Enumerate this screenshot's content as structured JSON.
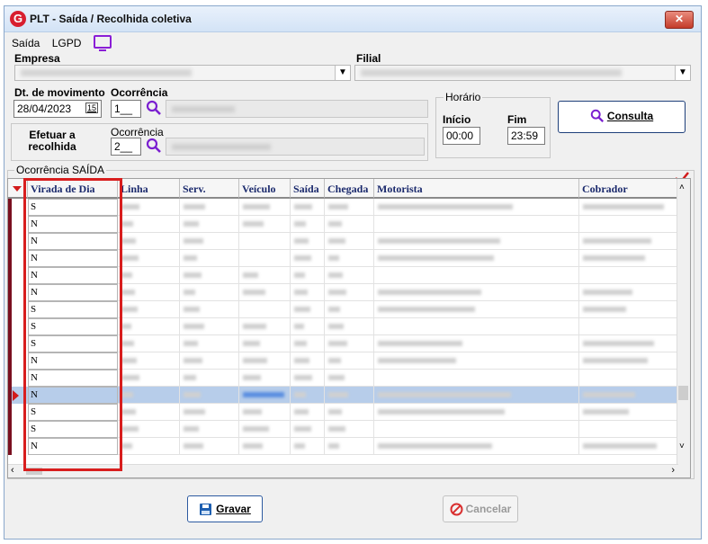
{
  "window": {
    "title": "PLT - Saída / Recolhida coletiva",
    "app_icon": "G",
    "close": "✕"
  },
  "menu": {
    "items": [
      "Saída",
      "LGPD"
    ],
    "icon": "monitor-icon"
  },
  "form": {
    "empresa_label": "Empresa",
    "filial_label": "Filial",
    "dt_label": "Dt. de movimento",
    "dt_value": "28/04/2023",
    "calendar_glyph": "15",
    "ocorrencia_label": "Ocorrência",
    "ocorrencia_value": "1__",
    "horario_label": "Horário",
    "inicio_label": "Início",
    "inicio_value": "00:00",
    "fim_label": "Fim",
    "fim_value": "23:59",
    "efetuar_label": "Efetuar a recolhida",
    "ocorrencia2_label": "Ocorrência",
    "ocorrencia2_value": "2__",
    "consulta_label": "Consulta"
  },
  "grid": {
    "group_title": "Ocorrência SAÍDA",
    "columns": [
      "Virada de Dia",
      "Linha",
      "Serv.",
      "Veículo",
      "Saída",
      "Chegada",
      "Motorista",
      "Cobrador"
    ],
    "virada_values": [
      "S",
      "N",
      "N",
      "N",
      "N",
      "N",
      "S",
      "S",
      "S",
      "N",
      "N",
      "N",
      "S",
      "S",
      "N"
    ],
    "selected_row": 11
  },
  "buttons": {
    "gravar": "Gravar",
    "cancelar": "Cancelar"
  },
  "colors": {
    "accent": "#2d5aa0",
    "highlight": "#d81e1e",
    "selection": "#b7cdea"
  }
}
